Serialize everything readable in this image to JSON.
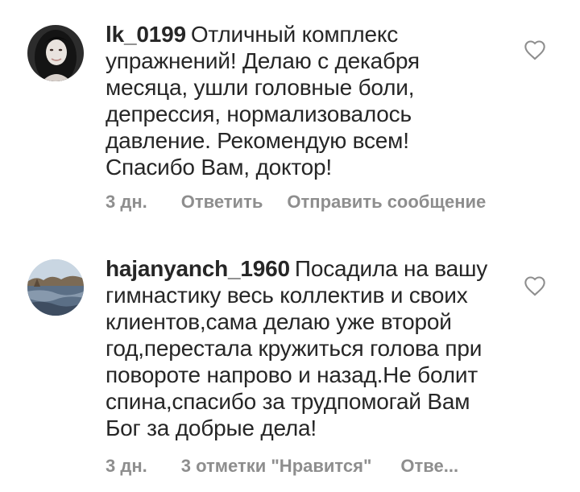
{
  "comments": [
    {
      "username": "lk_0199",
      "text": "Отличный комплекс\nупражнений! Делаю с декабря\nмесяца,  ушли головные боли,\nдепрессия, нормализовалось\nдавление.  Рекомендую всем!\nСпасибо Вам, доктор!",
      "time": "3 дн.",
      "reply_label": "Ответить",
      "message_label": "Отправить сообщение",
      "like_icon": "heart-outline-icon"
    },
    {
      "username": "hajanyanch_1960",
      "text": "Посадила на вашу\nгимнастику весь коллектив и своих\nклиентов,сама делаю уже второй\nгод,перестала кружиться голова при\nповороте напрово и назад.Не болит\nспина,спасибо за трудпомогай Вам\nБог за добрые дела!",
      "time": "3 дн.",
      "likes_label": "3 отметки \"Нравится\"",
      "reply_label": "Отве...",
      "like_icon": "heart-outline-icon"
    }
  ],
  "colors": {
    "text": "#262626",
    "secondary": "#8e8e8e",
    "background": "#ffffff"
  }
}
